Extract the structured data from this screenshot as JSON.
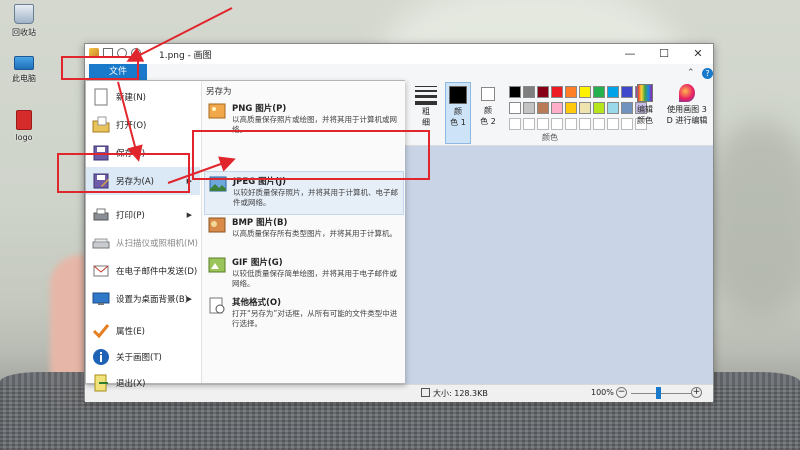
{
  "desktop": {
    "icons": [
      {
        "label": "回收站",
        "icon": "recycle-bin-icon"
      },
      {
        "label": "此电脑",
        "icon": "this-pc-icon"
      },
      {
        "label": "logo",
        "icon": "image-file-icon"
      }
    ]
  },
  "window": {
    "title": "1.png - 画图",
    "controls": {
      "minimize": "—",
      "maximize": "☐",
      "close": "✕"
    },
    "help_symbol": "?"
  },
  "ribbon": {
    "thickness_label_1": "粗",
    "thickness_label_2": "细",
    "color1_label_1": "颜",
    "color1_label_2": "色 1",
    "color2_label_1": "颜",
    "color2_label_2": "色 2",
    "palette_group_label": "颜色",
    "edit_colors_label_1": "编辑",
    "edit_colors_label_2": "颜色",
    "paint3d_label_1": "使用画图 3",
    "paint3d_label_2": "D 进行编辑",
    "palette_colors": [
      "#000000",
      "#7f7f7f",
      "#880015",
      "#ed1c24",
      "#ff7f27",
      "#fff200",
      "#22b14c",
      "#00a2e8",
      "#3f48cc",
      "#a349a4",
      "#ffffff",
      "#c3c3c3",
      "#b97a57",
      "#ffaec9",
      "#ffc90e",
      "#efe4b0",
      "#b5e61d",
      "#99d9ea",
      "#7092be",
      "#c8bfe7"
    ]
  },
  "file_menu": {
    "tab_label": "文件",
    "items": [
      {
        "label": "新建(N)",
        "icon": "new-document-icon",
        "has_submenu": false,
        "disabled": false
      },
      {
        "label": "打开(O)",
        "icon": "open-folder-icon",
        "has_submenu": false,
        "disabled": false
      },
      {
        "label": "保存(S)",
        "icon": "save-icon",
        "has_submenu": false,
        "disabled": false
      },
      {
        "label": "另存为(A)",
        "icon": "save-as-icon",
        "has_submenu": true,
        "disabled": false,
        "active": true
      },
      {
        "label": "打印(P)",
        "icon": "printer-icon",
        "has_submenu": true,
        "disabled": false
      },
      {
        "label": "从扫描仪或照相机(M)",
        "icon": "scanner-icon",
        "has_submenu": false,
        "disabled": true
      },
      {
        "label": "在电子邮件中发送(D)",
        "icon": "email-icon",
        "has_submenu": false,
        "disabled": false
      },
      {
        "label": "设置为桌面背景(B)",
        "icon": "desktop-background-icon",
        "has_submenu": true,
        "disabled": false
      },
      {
        "label": "属性(E)",
        "icon": "properties-check-icon",
        "has_submenu": false,
        "disabled": false
      },
      {
        "label": "关于画图(T)",
        "icon": "info-icon",
        "has_submenu": false,
        "disabled": false
      },
      {
        "label": "退出(X)",
        "icon": "exit-icon",
        "has_submenu": false,
        "disabled": false
      }
    ],
    "submenu_arrow": "▶"
  },
  "save_as": {
    "title": "另存为",
    "formats": [
      {
        "name": "PNG 图片(P)",
        "desc": "以高质量保存照片或绘图，并将其用于计算机或网络。",
        "icon": "png-image-icon"
      },
      {
        "name": "JPEG 图片(J)",
        "desc": "以较好质量保存照片，并将其用于计算机、电子邮件或网络。",
        "icon": "jpeg-image-icon",
        "highlighted": true
      },
      {
        "name": "BMP 图片(B)",
        "desc": "以高质量保存所有类型图片，并将其用于计算机。",
        "icon": "bmp-image-icon"
      },
      {
        "name": "GIF 图片(G)",
        "desc": "以较低质量保存简单绘图，并将其用于电子邮件或网络。",
        "icon": "gif-image-icon"
      },
      {
        "name": "其他格式(O)",
        "desc": "打开“另存为”对话框，从所有可能的文件类型中进行选择。",
        "icon": "other-formats-icon"
      }
    ]
  },
  "statusbar": {
    "size_text": "大小: 128.3KB",
    "zoom": "100%",
    "zoom_out": "−",
    "zoom_in": "+"
  }
}
